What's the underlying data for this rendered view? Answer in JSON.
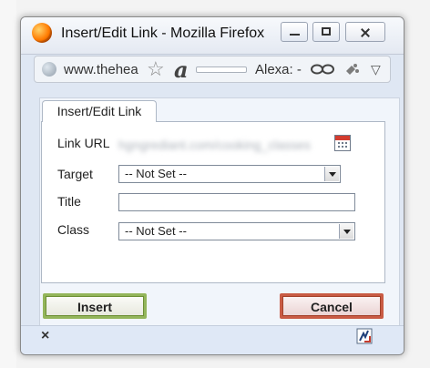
{
  "window": {
    "title": "Insert/Edit Link - Mozilla Firefox",
    "url_prefix": "www.thehea",
    "url_extension_text": "Alexa: -",
    "icons": [
      "firefox-icon",
      "globe-icon",
      "star-icon",
      "a-icon",
      "link-icon",
      "puzzle-icon",
      "menu-arrow-icon"
    ]
  },
  "dialog": {
    "tab_label": "Insert/Edit Link",
    "labels": {
      "link_url": "Link URL",
      "target": "Target",
      "title": "Title",
      "class": "Class"
    },
    "fields": {
      "link_url_value": "hgngrediant.com/cooking_classes",
      "target_value": "-- Not Set --",
      "title_value": "",
      "class_value": "-- Not Set --"
    },
    "buttons": {
      "insert": "Insert",
      "cancel": "Cancel"
    }
  },
  "statusbar": {
    "close_label": "×",
    "icon": "progress-icon"
  }
}
